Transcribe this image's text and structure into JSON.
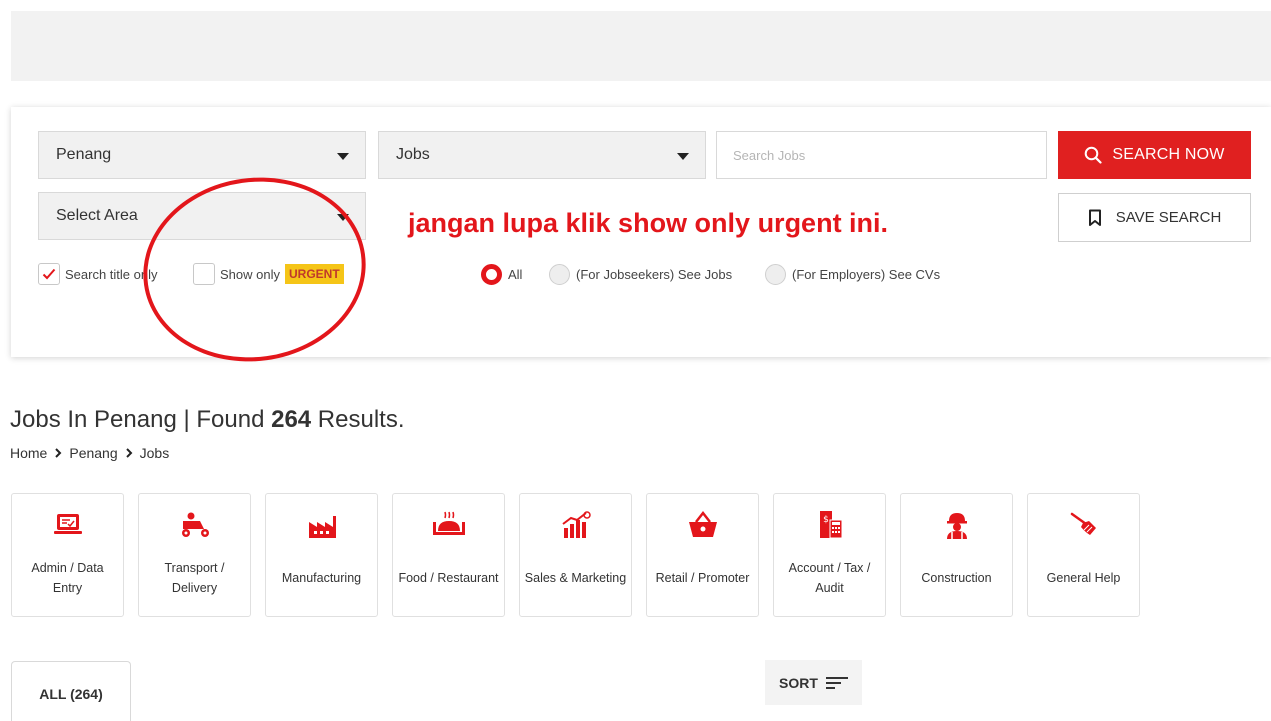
{
  "search": {
    "state_value": "Penang",
    "type_value": "Jobs",
    "area_placeholder": "Select Area",
    "keyword_placeholder": "Search Jobs",
    "search_button": "SEARCH NOW",
    "save_button": "SAVE SEARCH",
    "search_title_only": "Search title only",
    "search_title_only_checked": true,
    "show_only": "Show only",
    "urgent": "URGENT",
    "show_urgent_checked": false,
    "radios": [
      {
        "label": "All",
        "checked": true
      },
      {
        "label": "(For Jobseekers) See Jobs",
        "checked": false
      },
      {
        "label": "(For Employers) See CVs",
        "checked": false
      }
    ]
  },
  "annotation": "jangan lupa klik show only urgent ini.",
  "results": {
    "title_prefix": "Jobs In Penang | Found ",
    "count": "264",
    "title_suffix": " Results."
  },
  "breadcrumb": [
    "Home",
    "Penang",
    "Jobs"
  ],
  "categories": [
    {
      "label": "Admin / Data Entry",
      "icon": "computer-icon"
    },
    {
      "label": "Transport / Delivery",
      "icon": "scooter-icon"
    },
    {
      "label": "Manufacturing",
      "icon": "factory-icon"
    },
    {
      "label": "Food / Restaurant",
      "icon": "food-tray-icon"
    },
    {
      "label": "Sales & Marketing",
      "icon": "growth-chart-icon"
    },
    {
      "label": "Retail / Promoter",
      "icon": "basket-icon"
    },
    {
      "label": "Account / Tax / Audit",
      "icon": "calculator-icon"
    },
    {
      "label": "Construction",
      "icon": "worker-helmet-icon"
    },
    {
      "label": "General Help",
      "icon": "broom-icon"
    }
  ],
  "tabs": {
    "all": "ALL (264)"
  },
  "sort": {
    "label": "SORT"
  },
  "colors": {
    "accent": "#e02020",
    "urgent_bg": "#f5c518"
  }
}
